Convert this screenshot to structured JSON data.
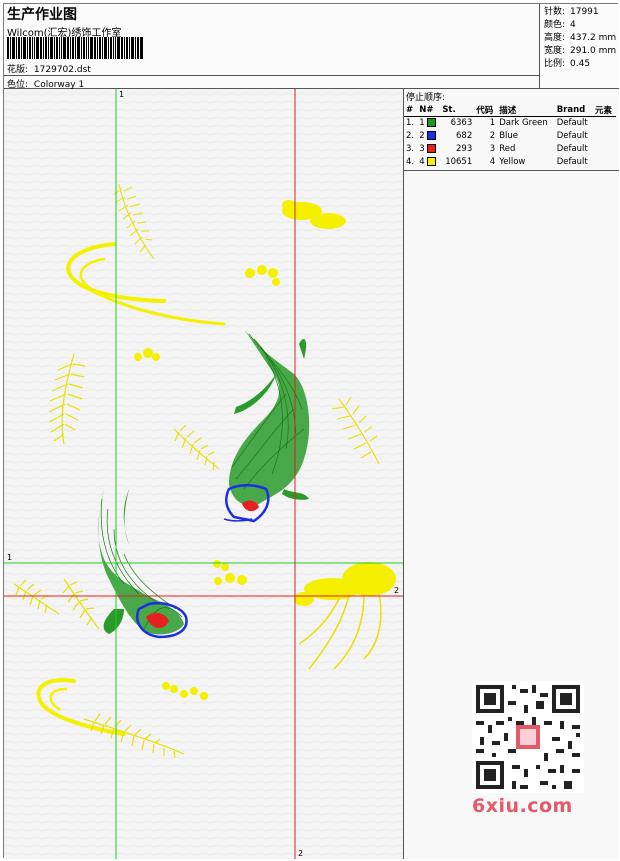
{
  "header": {
    "title": "生产作业图",
    "company": "Wilcom(汇宏)绣饰工作室",
    "design_label": "花版:",
    "design_value": "1729702.dst",
    "colorway_label": "色位:",
    "colorway_value": "Colorway 1"
  },
  "stats": [
    {
      "key": "针数:",
      "value": "17991"
    },
    {
      "key": "颜色:",
      "value": "4"
    },
    {
      "key": "高度:",
      "value": "437.2 mm"
    },
    {
      "key": "宽度:",
      "value": "291.0 mm"
    },
    {
      "key": "比例:",
      "value": "0.45"
    }
  ],
  "panel": {
    "heading": "停止顺序:",
    "columns": [
      "#",
      "N#",
      "St.",
      "代码",
      "描述",
      "Brand",
      "元素"
    ],
    "rows": [
      {
        "idx": "1.",
        "n": "1",
        "color": "#1a9a1a",
        "st": "6363",
        "code": "1",
        "desc": "Dark Green",
        "brand": "Default"
      },
      {
        "idx": "2.",
        "n": "2",
        "color": "#1a2ee6",
        "st": "682",
        "code": "2",
        "desc": "Blue",
        "brand": "Default"
      },
      {
        "idx": "3.",
        "n": "3",
        "color": "#e62020",
        "st": "293",
        "code": "3",
        "desc": "Red",
        "brand": "Default"
      },
      {
        "idx": "4.",
        "n": "4",
        "color": "#f5f000",
        "st": "10651",
        "code": "4",
        "desc": "Yellow",
        "brand": "Default"
      }
    ]
  },
  "axes": {
    "green_v": "1",
    "green_h": "1",
    "red_v": "2",
    "red_h": "2"
  },
  "watermark": {
    "text": "6xiu.com"
  },
  "colors": {
    "thread_dark_green": "#1a9a1a",
    "thread_blue": "#1a2ee6",
    "thread_red": "#e62020",
    "thread_yellow": "#f5f000",
    "guide_green": "#22cc22",
    "guide_red": "#dd2222"
  }
}
